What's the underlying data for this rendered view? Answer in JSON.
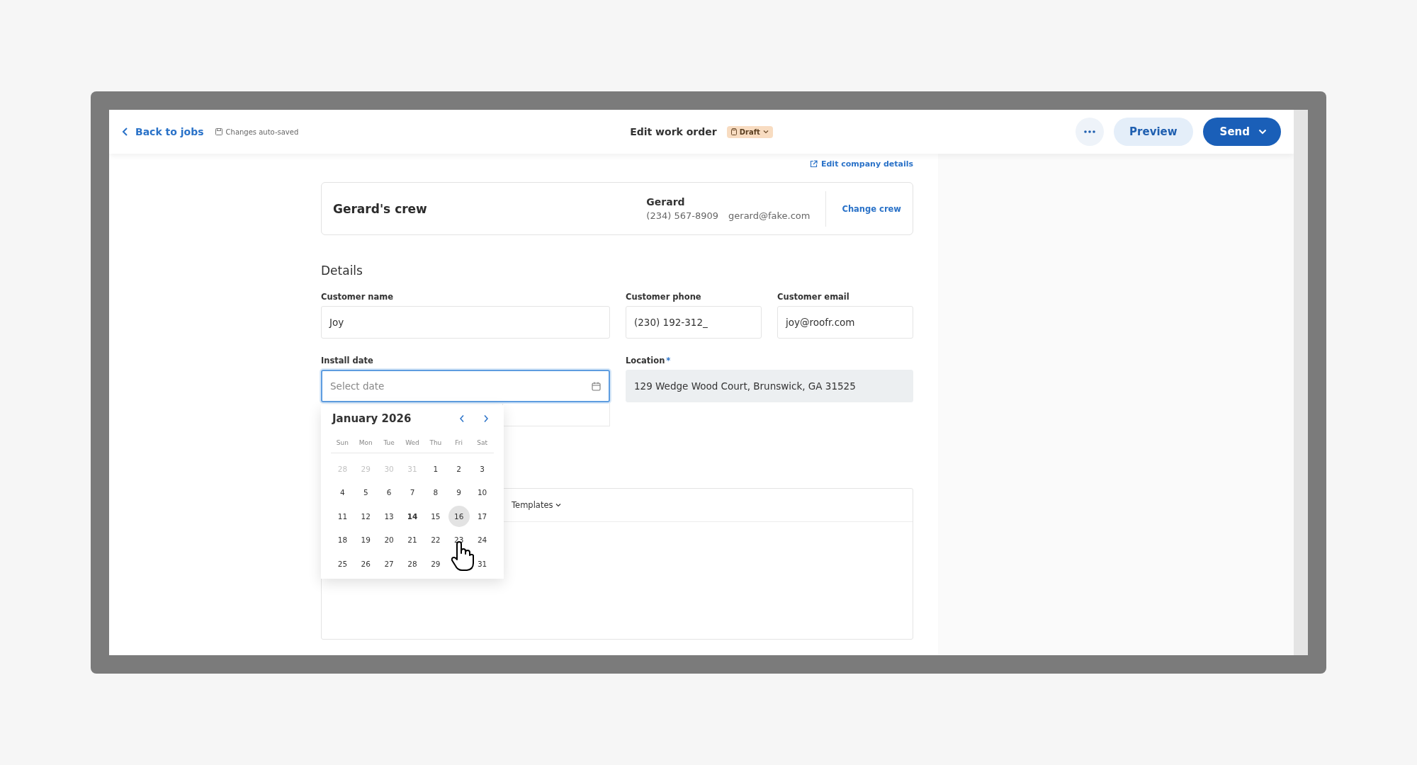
{
  "header": {
    "back_link": "Back to jobs",
    "autosave": "Changes auto-saved",
    "title": "Edit work order",
    "status": "Draft",
    "preview": "Preview",
    "send": "Send"
  },
  "edit_company_link": "Edit company details",
  "crew_card": {
    "name": "Gerard's crew",
    "contact_name": "Gerard",
    "phone": "(234) 567-8909",
    "email": "gerard@fake.com",
    "action": "Change crew"
  },
  "details": {
    "heading": "Details",
    "fields": [
      {
        "kind": "text",
        "label": "Customer name",
        "value": "Joy",
        "focused": false,
        "disabled": false
      },
      {
        "kind": "text",
        "label": "Customer phone",
        "value": "(230) 192-312_",
        "focused": false,
        "disabled": false
      },
      {
        "kind": "text",
        "label": "Customer email",
        "value": "joy@roofr.com",
        "focused": false,
        "disabled": false
      },
      {
        "kind": "date",
        "label": "Install date",
        "placeholder": "Select date",
        "focused": true,
        "disabled": false
      },
      {
        "kind": "address",
        "label": "Location",
        "required_mark": "*",
        "value": "129 Wedge Wood Court, Brunswick, GA 31525",
        "focused": false,
        "disabled": true
      }
    ]
  },
  "calendar": {
    "month": "January 2026",
    "weekdays": [
      "Sun",
      "Mon",
      "Tue",
      "Wed",
      "Thu",
      "Fri",
      "Sat"
    ],
    "days": [
      {
        "label": "28",
        "outside": true,
        "today": false,
        "selected": false
      },
      {
        "label": "29",
        "outside": true,
        "today": false,
        "selected": false
      },
      {
        "label": "30",
        "outside": true,
        "today": false,
        "selected": false
      },
      {
        "label": "31",
        "outside": true,
        "today": false,
        "selected": false
      },
      {
        "label": "1",
        "outside": false,
        "today": false,
        "selected": false
      },
      {
        "label": "2",
        "outside": false,
        "today": false,
        "selected": false
      },
      {
        "label": "3",
        "outside": false,
        "today": false,
        "selected": false
      },
      {
        "label": "4",
        "outside": false,
        "today": false,
        "selected": false
      },
      {
        "label": "5",
        "outside": false,
        "today": false,
        "selected": false
      },
      {
        "label": "6",
        "outside": false,
        "today": false,
        "selected": false
      },
      {
        "label": "7",
        "outside": false,
        "today": false,
        "selected": false
      },
      {
        "label": "8",
        "outside": false,
        "today": false,
        "selected": false
      },
      {
        "label": "9",
        "outside": false,
        "today": false,
        "selected": false
      },
      {
        "label": "10",
        "outside": false,
        "today": false,
        "selected": false
      },
      {
        "label": "11",
        "outside": false,
        "today": false,
        "selected": false
      },
      {
        "label": "12",
        "outside": false,
        "today": false,
        "selected": false
      },
      {
        "label": "13",
        "outside": false,
        "today": false,
        "selected": false
      },
      {
        "label": "14",
        "outside": false,
        "today": true,
        "selected": false
      },
      {
        "label": "15",
        "outside": false,
        "today": false,
        "selected": false
      },
      {
        "label": "16",
        "outside": false,
        "today": false,
        "selected": true
      },
      {
        "label": "17",
        "outside": false,
        "today": false,
        "selected": false
      },
      {
        "label": "18",
        "outside": false,
        "today": false,
        "selected": false
      },
      {
        "label": "19",
        "outside": false,
        "today": false,
        "selected": false
      },
      {
        "label": "20",
        "outside": false,
        "today": false,
        "selected": false
      },
      {
        "label": "21",
        "outside": false,
        "today": false,
        "selected": false
      },
      {
        "label": "22",
        "outside": false,
        "today": false,
        "selected": false
      },
      {
        "label": "23",
        "outside": false,
        "today": false,
        "selected": false
      },
      {
        "label": "24",
        "outside": false,
        "today": false,
        "selected": false
      },
      {
        "label": "25",
        "outside": false,
        "today": false,
        "selected": false
      },
      {
        "label": "26",
        "outside": false,
        "today": false,
        "selected": false
      },
      {
        "label": "27",
        "outside": false,
        "today": false,
        "selected": false
      },
      {
        "label": "28",
        "outside": false,
        "today": false,
        "selected": false
      },
      {
        "label": "29",
        "outside": false,
        "today": false,
        "selected": false
      },
      {
        "kind": "covered"
      },
      {
        "label": "31",
        "outside": false,
        "today": false,
        "selected": false
      }
    ]
  },
  "editor": {
    "templates": "Templates"
  }
}
